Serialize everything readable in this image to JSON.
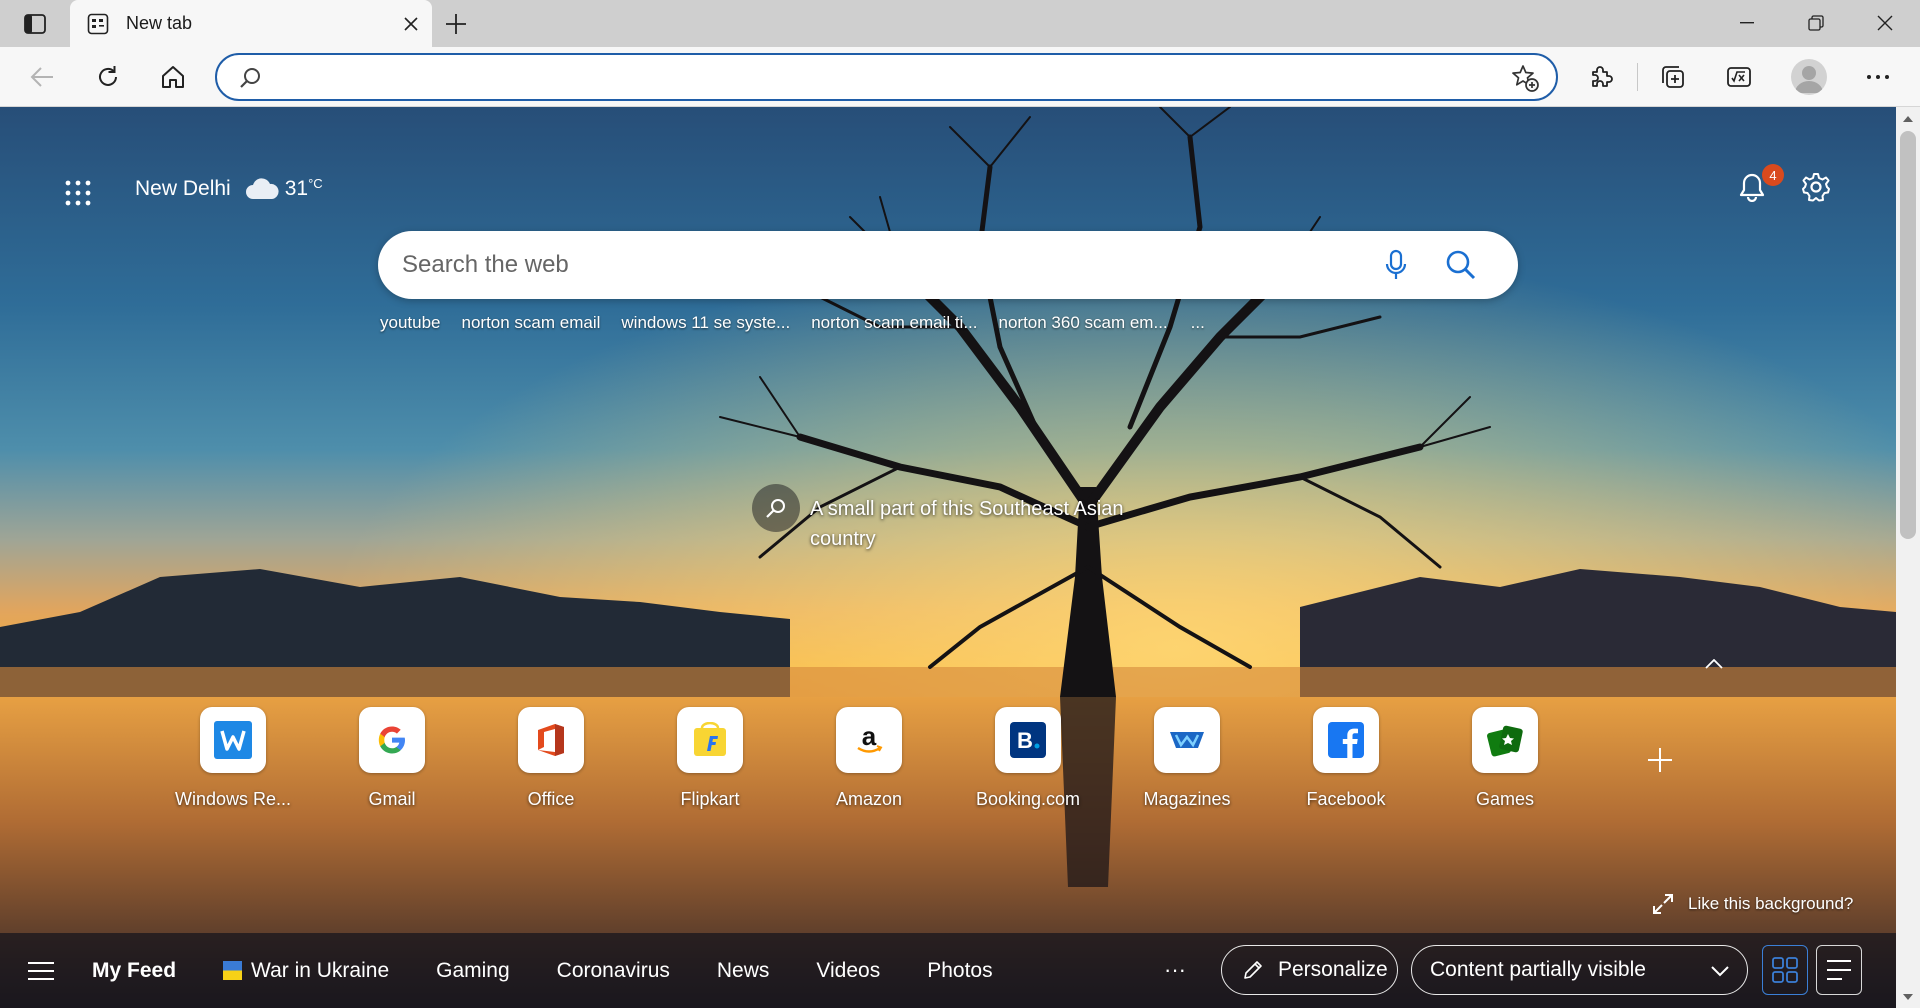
{
  "tab": {
    "title": "New tab"
  },
  "addressbar": {
    "value": "",
    "placeholder": ""
  },
  "header": {
    "city": "New Delhi",
    "temperature": "31",
    "temperature_unit": "°C",
    "notification_count": "4"
  },
  "search": {
    "placeholder": "Search the web",
    "trending": [
      "youtube",
      "norton scam email",
      "windows 11 se syste...",
      "norton scam email ti...",
      "norton 360 scam em..."
    ],
    "more": "..."
  },
  "image_info": {
    "caption": "A small part of this Southeast Asian country"
  },
  "quick_links": [
    {
      "label": "Windows Re...",
      "icon": "windows-report-icon",
      "color": "#1e88e5"
    },
    {
      "label": "Gmail",
      "icon": "google-icon",
      "color": "#4285f4"
    },
    {
      "label": "Office",
      "icon": "office-icon",
      "color": "#e34a1d"
    },
    {
      "label": "Flipkart",
      "icon": "flipkart-icon",
      "color": "#f8d533"
    },
    {
      "label": "Amazon",
      "icon": "amazon-icon",
      "color": "#111111"
    },
    {
      "label": "Booking.com",
      "icon": "booking-icon",
      "color": "#003580"
    },
    {
      "label": "Magazines",
      "icon": "magazines-icon",
      "color": "#1b67c5"
    },
    {
      "label": "Facebook",
      "icon": "facebook-icon",
      "color": "#1877f2"
    },
    {
      "label": "Games",
      "icon": "games-icon",
      "color": "#107c10"
    }
  ],
  "like_background": "Like this background?",
  "feed": {
    "items": [
      "My Feed",
      "War in Ukraine",
      "Gaming",
      "Coronavirus",
      "News",
      "Videos",
      "Photos"
    ],
    "more": "···",
    "personalize": "Personalize",
    "visibility": "Content partially visible"
  }
}
